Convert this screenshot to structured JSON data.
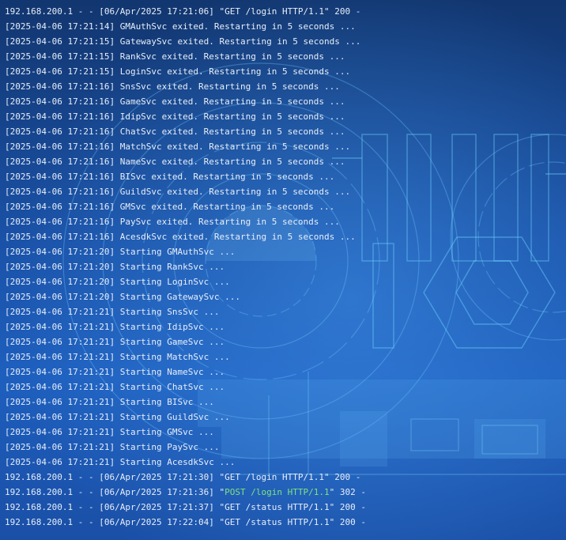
{
  "terminal": {
    "lines": [
      {
        "text": "192.168.200.1 - - [06/Apr/2025 17:21:06] \"GET /login HTTP/1.1\" 200 -"
      },
      {
        "text": "[2025-04-06 17:21:14] GMAuthSvc exited. Restarting in 5 seconds ..."
      },
      {
        "text": "[2025-04-06 17:21:15] GatewaySvc exited. Restarting in 5 seconds ..."
      },
      {
        "text": "[2025-04-06 17:21:15] RankSvc exited. Restarting in 5 seconds ..."
      },
      {
        "text": "[2025-04-06 17:21:15] LoginSvc exited. Restarting in 5 seconds ..."
      },
      {
        "text": "[2025-04-06 17:21:16] SnsSvc exited. Restarting in 5 seconds ..."
      },
      {
        "text": "[2025-04-06 17:21:16] GameSvc exited. Restarting in 5 seconds ..."
      },
      {
        "text": "[2025-04-06 17:21:16] IdipSvc exited. Restarting in 5 seconds ..."
      },
      {
        "text": "[2025-04-06 17:21:16] ChatSvc exited. Restarting in 5 seconds ..."
      },
      {
        "text": "[2025-04-06 17:21:16] MatchSvc exited. Restarting in 5 seconds ..."
      },
      {
        "text": "[2025-04-06 17:21:16] NameSvc exited. Restarting in 5 seconds ..."
      },
      {
        "text": "[2025-04-06 17:21:16] BISvc exited. Restarting in 5 seconds ..."
      },
      {
        "text": "[2025-04-06 17:21:16] GuildSvc exited. Restarting in 5 seconds ..."
      },
      {
        "text": "[2025-04-06 17:21:16] GMSvc exited. Restarting in 5 seconds ..."
      },
      {
        "text": "[2025-04-06 17:21:16] PaySvc exited. Restarting in 5 seconds ..."
      },
      {
        "text": "[2025-04-06 17:21:16] AcesdkSvc exited. Restarting in 5 seconds ..."
      },
      {
        "text": "[2025-04-06 17:21:20] Starting GMAuthSvc ..."
      },
      {
        "text": "[2025-04-06 17:21:20] Starting RankSvc ..."
      },
      {
        "text": "[2025-04-06 17:21:20] Starting LoginSvc ..."
      },
      {
        "text": "[2025-04-06 17:21:20] Starting GatewaySvc ..."
      },
      {
        "text": "[2025-04-06 17:21:21] Starting SnsSvc ..."
      },
      {
        "text": "[2025-04-06 17:21:21] Starting IdipSvc ..."
      },
      {
        "text": "[2025-04-06 17:21:21] Starting GameSvc ..."
      },
      {
        "text": "[2025-04-06 17:21:21] Starting MatchSvc ..."
      },
      {
        "text": "[2025-04-06 17:21:21] Starting NameSvc ..."
      },
      {
        "text": "[2025-04-06 17:21:21] Starting ChatSvc ..."
      },
      {
        "text": "[2025-04-06 17:21:21] Starting BISvc ..."
      },
      {
        "text": "[2025-04-06 17:21:21] Starting GuildSvc ..."
      },
      {
        "text": "[2025-04-06 17:21:21] Starting GMSvc ..."
      },
      {
        "text": "[2025-04-06 17:21:21] Starting PaySvc ..."
      },
      {
        "text": "[2025-04-06 17:21:21] Starting AcesdkSvc ..."
      },
      {
        "text": "192.168.200.1 - - [06/Apr/2025 17:21:30] \"GET /login HTTP/1.1\" 200 -"
      },
      {
        "prefix": "192.168.200.1 - - [06/Apr/2025 17:21:36] \"",
        "highlight": "POST /login HTTP/1.1",
        "suffix": "\" 302 -"
      },
      {
        "text": "192.168.200.1 - - [06/Apr/2025 17:21:37] \"GET /status HTTP/1.1\" 200 -"
      },
      {
        "text": "192.168.200.1 - - [06/Apr/2025 17:22:04] \"GET /status HTTP/1.1\" 200 -"
      }
    ]
  }
}
